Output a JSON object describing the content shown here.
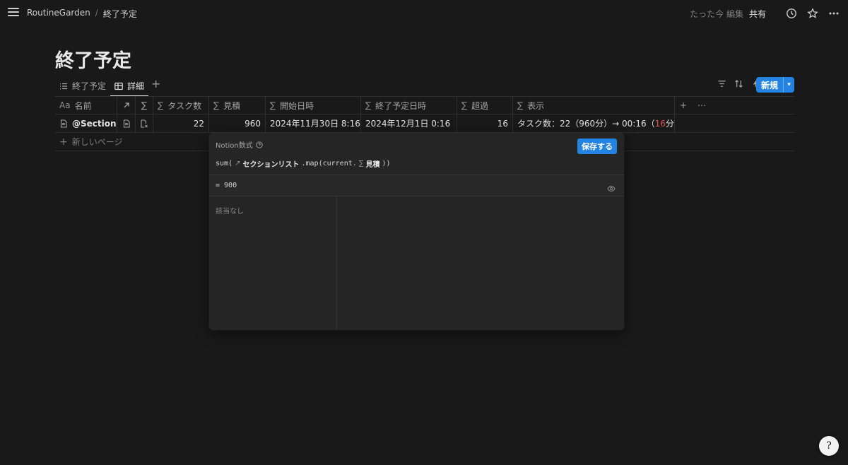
{
  "topbar": {
    "breadcrumb": [
      "RoutineGarden",
      "/",
      "終了予定"
    ],
    "edited": "たった今 編集",
    "share": "共有"
  },
  "page": {
    "title": "終了予定"
  },
  "views": {
    "tabs": [
      {
        "label": "終了予定",
        "icon": "list-icon"
      },
      {
        "label": "詳細",
        "icon": "table-icon"
      }
    ],
    "new_button": "新規"
  },
  "table": {
    "headers": {
      "name_prefix": "Aa",
      "name": "名前",
      "tasks": "タスク数",
      "estimate": "見積",
      "start": "開始日時",
      "end": "終了予定日時",
      "over": "超過",
      "display": "表示",
      "sigma": "∑"
    },
    "row": {
      "name": "@Sections",
      "tasks": "22",
      "estimate": "960",
      "start": "2024年11月30日 8:16",
      "end": "2024年12月1日 0:16",
      "over": "16",
      "display_main": "タスク数：22（960分）→ 00:16（",
      "display_red": "16",
      "display_tail": "分）"
    },
    "new_page": "新しいページ"
  },
  "formula_popup": {
    "title": "Notion数式",
    "save": "保存する",
    "formula_prefix": "sum(",
    "formula_token": "セクションリスト",
    "formula_mid": ".map(current.",
    "formula_token2": "見積",
    "formula_suffix": "))",
    "result": "= 900",
    "empty_label": "該当なし"
  },
  "colors": {
    "accent": "#2383e2",
    "background": "#191919",
    "warning_red": "#e5534b"
  }
}
